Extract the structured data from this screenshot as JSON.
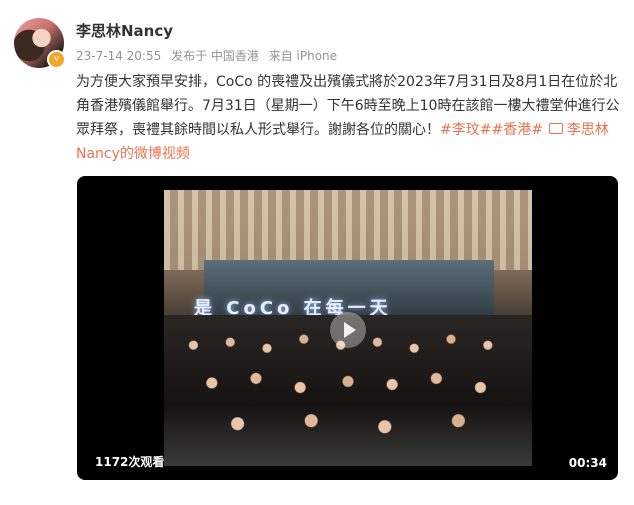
{
  "user": {
    "name": "李思林Nancy",
    "avatar_icon": "avatar",
    "badge_icon": "verified-badge-icon"
  },
  "meta": {
    "date": "23-7-14 20:55",
    "location": "发布于 中国香港",
    "source": "来自 iPhone"
  },
  "post": {
    "text": "为方便大家預早安排，CoCo 的喪禮及出殯儀式將於2023年7月31日及8月1日在位於北角香港殯儀館舉行。7月31日（星期一）下午6時至晚上10時在該館一樓大禮堂仲進行公眾拜祭，喪禮其餘時間以私人形式舉行。謝謝各位的關心！",
    "hashtag": "#李玟##香港#",
    "video_link": "李思林Nancy的微博视频",
    "link_color": "#eb7350"
  },
  "video": {
    "overlay_text": "是 CoCo 在每一天",
    "views": "1172次观看",
    "duration": "00:34"
  }
}
